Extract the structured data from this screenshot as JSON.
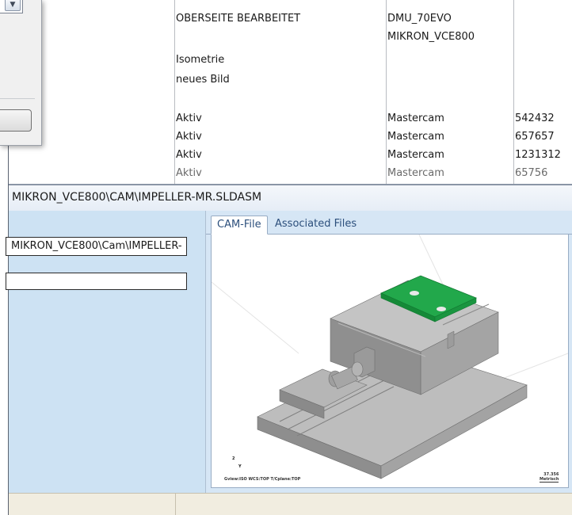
{
  "table": {
    "col_a": {
      "row0": "OBERSEITE BEARBEITET",
      "row1": "Isometrie",
      "row2": "neues Bild",
      "row3": "Aktiv",
      "row4": "Aktiv",
      "row5": "Aktiv",
      "row6": "Aktiv"
    },
    "col_b": {
      "row0": "DMU_70EVO",
      "row1": "MIKRON_VCE800",
      "row3": "Mastercam",
      "row4": "Mastercam",
      "row5": "Mastercam",
      "row6": "Mastercam"
    },
    "col_c": {
      "row3": "542432",
      "row4": "657657",
      "row5": "1231312",
      "row6": "65756"
    }
  },
  "path_bar": {
    "text": "MIKRON_VCE800\\CAM\\IMPELLER-MR.SLDASM"
  },
  "left_pane": {
    "field_path": "MIKRON_VCE800\\Cam\\IMPELLER-",
    "field_empty": ""
  },
  "tabs": {
    "cam_file": "CAM-File",
    "associated_files": "Associated Files"
  },
  "viewport": {
    "status": "Gview:ISO  WCS:TOP  T/Cplane:TOP",
    "scale_value": "37.356",
    "scale_unit": "Metrisch",
    "axis_2": "2",
    "axis_y": "Y"
  },
  "icons": {
    "dropdown": "chevron-down-icon"
  },
  "colors": {
    "model_body": "#a9a9a9",
    "model_highlight": "#1fa84a",
    "pane_background": "#d6e6f5"
  }
}
